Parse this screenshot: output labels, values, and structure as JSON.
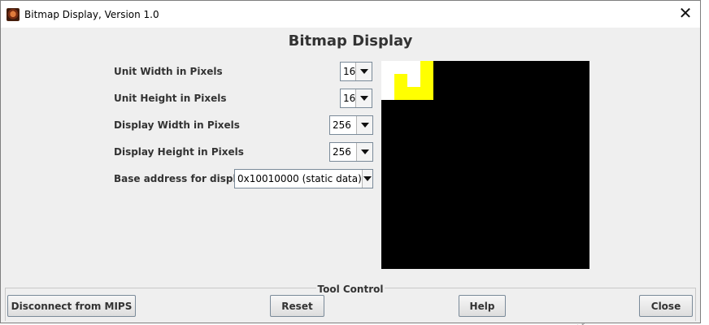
{
  "window": {
    "title": "Bitmap Display, Version 1.0",
    "close_glyph": "✕",
    "icon": "mars-app-icon"
  },
  "heading": "Bitmap Display",
  "settings": {
    "unit_width": {
      "label": "Unit Width in Pixels",
      "value": "16"
    },
    "unit_height": {
      "label": "Unit Height in Pixels",
      "value": "16"
    },
    "display_width": {
      "label": "Display Width in Pixels",
      "value": "256"
    },
    "display_height": {
      "label": "Display Height in Pixels",
      "value": "256"
    },
    "base_address": {
      "label": "Base address for display",
      "value": "0x10010000 (static data)"
    }
  },
  "bitmap": {
    "grid": "16x16 units",
    "background_color": "#000000",
    "painted_units": [
      {
        "col": 0,
        "row": 0,
        "color": "#ffffff"
      },
      {
        "col": 1,
        "row": 0,
        "color": "#ffffff"
      },
      {
        "col": 2,
        "row": 0,
        "color": "#ffffff"
      },
      {
        "col": 3,
        "row": 0,
        "color": "#ffff00"
      },
      {
        "col": 0,
        "row": 1,
        "color": "#ffffff"
      },
      {
        "col": 1,
        "row": 1,
        "color": "#ffff00"
      },
      {
        "col": 2,
        "row": 1,
        "color": "#ffffff"
      },
      {
        "col": 3,
        "row": 1,
        "color": "#ffff00"
      },
      {
        "col": 0,
        "row": 2,
        "color": "#ffffff"
      },
      {
        "col": 1,
        "row": 2,
        "color": "#ffff00"
      },
      {
        "col": 2,
        "row": 2,
        "color": "#ffff00"
      },
      {
        "col": 3,
        "row": 2,
        "color": "#ffff00"
      }
    ]
  },
  "tool_control": {
    "legend": "Tool Control",
    "disconnect_label": "Disconnect from MIPS",
    "reset_label": "Reset",
    "help_label": "Help",
    "close_label": "Close"
  },
  "backdrop": {
    "marks_top": "¦ ↙",
    "marks_bottom": "¦ ↙"
  }
}
